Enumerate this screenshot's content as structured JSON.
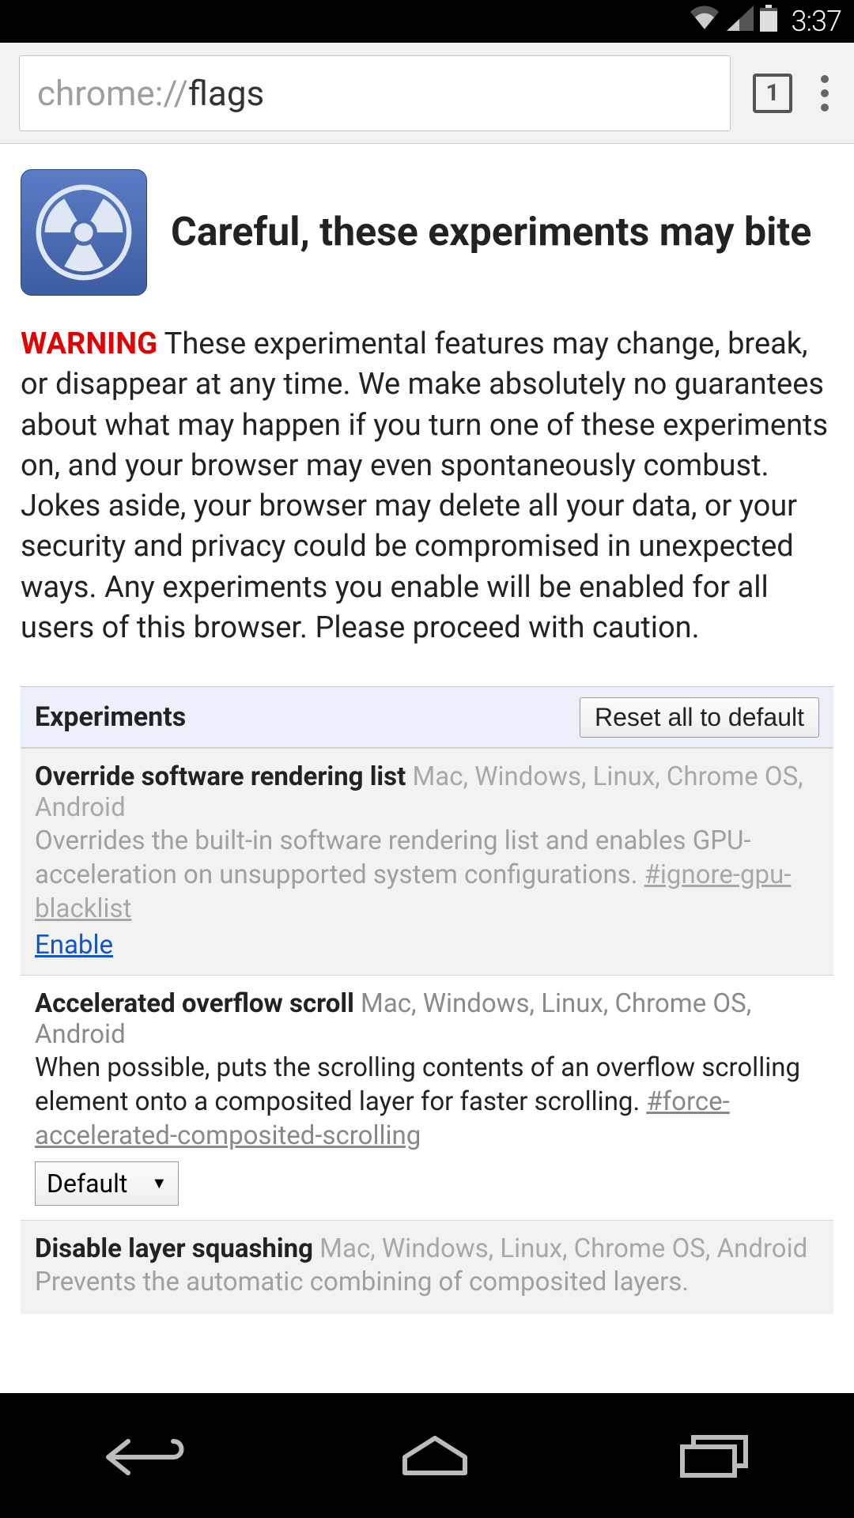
{
  "status": {
    "time": "3:37"
  },
  "chrome": {
    "url_scheme": "chrome://",
    "url_path": "flags",
    "tab_count": "1"
  },
  "hero": {
    "title": "Careful, these experiments may bite"
  },
  "warning": {
    "label": "WARNING",
    "text": " These experimental features may change, break, or disappear at any time. We make absolutely no guarantees about what may happen if you turn one of these experiments on, and your browser may even spontaneously combust. Jokes aside, your browser may delete all your data, or your security and privacy could be compromised in unexpected ways. Any experiments you enable will be enabled for all users of this browser. Please proceed with caution."
  },
  "section": {
    "title": "Experiments",
    "reset_label": "Reset all to default"
  },
  "experiments": [
    {
      "title": "Override software rendering list",
      "platforms": " Mac, Windows, Linux, Chrome OS, Android",
      "desc": "Overrides the built-in software rendering list and enables GPU-acceleration on unsupported system configurations. ",
      "hash": "#ignore-gpu-blacklist",
      "action": "Enable"
    },
    {
      "title": "Accelerated overflow scroll",
      "platforms": " Mac, Windows, Linux, Chrome OS, Android",
      "desc": "When possible, puts the scrolling contents of an overflow scrolling element onto a composited layer for faster scrolling. ",
      "hash": "#force-accelerated-composited-scrolling",
      "select": "Default"
    },
    {
      "title": "Disable layer squashing",
      "platforms": " Mac, Windows, Linux, Chrome OS, Android",
      "desc": "Prevents the automatic combining of composited layers.",
      "hash": ""
    }
  ]
}
